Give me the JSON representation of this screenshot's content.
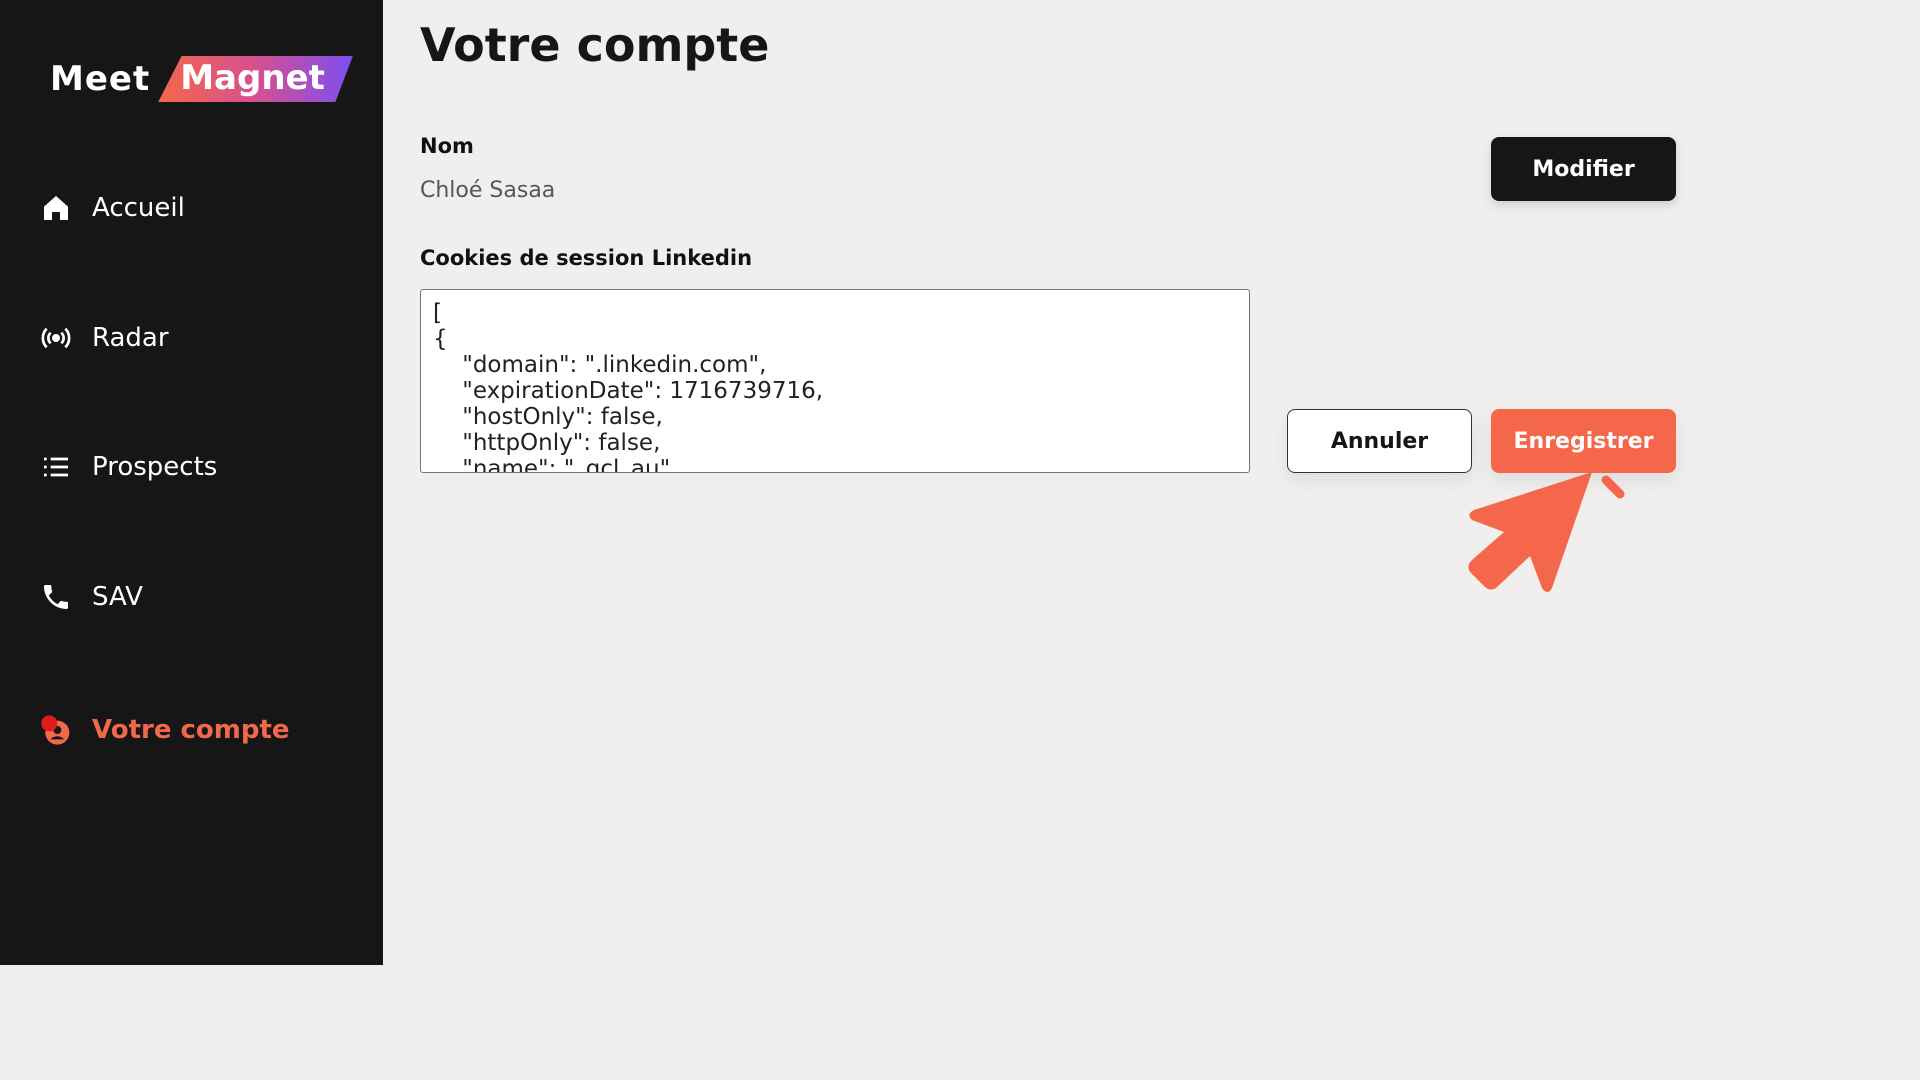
{
  "logo": {
    "part1": "Meet",
    "part2": "Magnet"
  },
  "sidebar": {
    "items": [
      {
        "label": "Accueil",
        "icon": "home-icon"
      },
      {
        "label": "Radar",
        "icon": "radar-icon"
      },
      {
        "label": "Prospects",
        "icon": "list-icon"
      },
      {
        "label": "SAV",
        "icon": "phone-icon"
      },
      {
        "label": "Votre compte",
        "icon": "user-icon",
        "active": true
      }
    ]
  },
  "page": {
    "title": "Votre compte",
    "name_label": "Nom",
    "name_value": "Chloé Sasaa",
    "cookies_label": "Cookies de session Linkedin",
    "cookies_value": "[\n{\n    \"domain\": \".linkedin.com\",\n    \"expirationDate\": 1716739716,\n    \"hostOnly\": false,\n    \"httpOnly\": false,\n    \"name\": \"_gcl_au\",",
    "modify_label": "Modifier",
    "cancel_label": "Annuler",
    "save_label": "Enregistrer"
  },
  "colors": {
    "accent": "#f4674a",
    "sidebar": "#171616",
    "background": "#f0efee"
  }
}
